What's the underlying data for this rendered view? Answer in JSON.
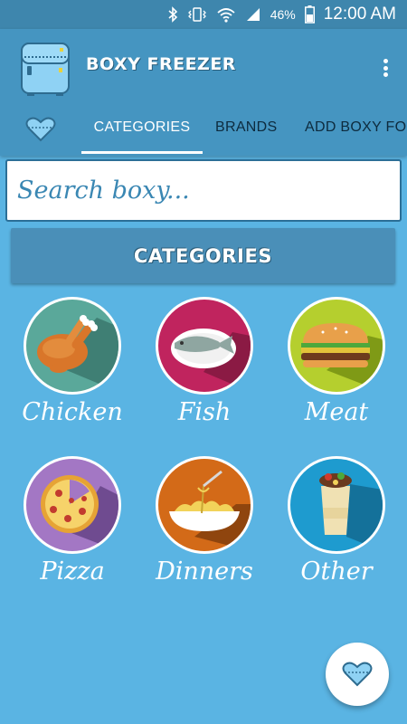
{
  "status_bar": {
    "icons": [
      "bluetooth-icon",
      "vibrate-icon",
      "wifi-icon",
      "signal-icon",
      "battery-icon"
    ],
    "battery": "46%",
    "time": "12:00 AM"
  },
  "app_bar": {
    "title": "BOXY FREEZER",
    "logo_icon": "freezer-logo-icon",
    "menu_icon": "overflow-menu-icon"
  },
  "tabs": [
    {
      "label": "CATEGORIES",
      "active": true
    },
    {
      "label": "BRANDS",
      "active": false
    },
    {
      "label": "ADD BOXY FOO",
      "active": false
    }
  ],
  "favorites_tab_icon": "heart-icon",
  "search": {
    "placeholder": "Search boxy..."
  },
  "section_header": "CATEGORIES",
  "categories": [
    {
      "label": "Chicken",
      "icon": "chicken-icon",
      "color": "#5aa89a"
    },
    {
      "label": "Fish",
      "icon": "fish-icon",
      "color": "#c0245e"
    },
    {
      "label": "Meat",
      "icon": "burger-icon",
      "color": "#b5cf2e"
    },
    {
      "label": "Pizza",
      "icon": "pizza-icon",
      "color": "#a377c4"
    },
    {
      "label": "Dinners",
      "icon": "spaghetti-icon",
      "color": "#d36a18"
    },
    {
      "label": "Other",
      "icon": "burrito-icon",
      "color": "#1e9bcf"
    }
  ],
  "fab": {
    "icon": "heart-icon"
  },
  "colors": {
    "background": "#5ab4e3",
    "status_bar": "#3e86ad",
    "app_bar": "#4595c1",
    "header": "#4a8fb8",
    "accent_text": "#3a87b3"
  }
}
